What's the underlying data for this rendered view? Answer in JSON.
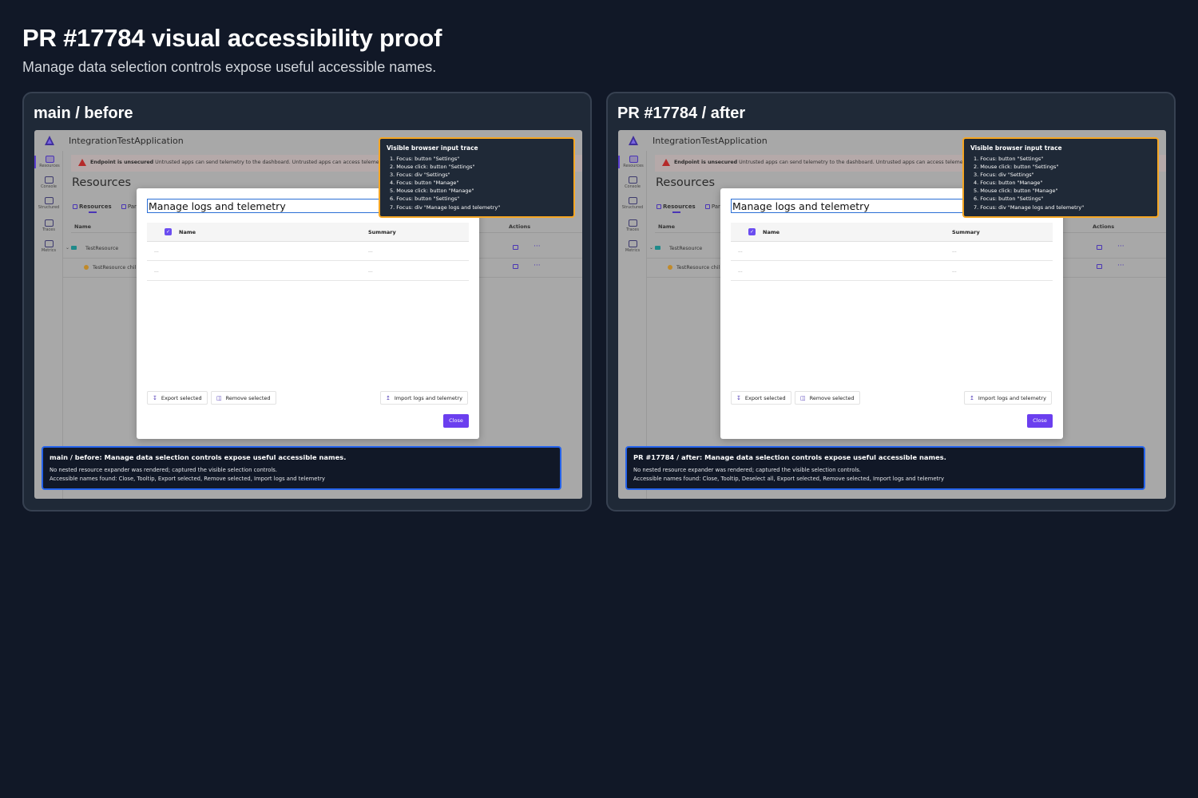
{
  "page": {
    "title": "PR #17784 visual accessibility proof",
    "subtitle": "Manage data selection controls expose useful accessible names."
  },
  "colors": {
    "background": "#111827",
    "panel": "#1f2937",
    "accent": "#6b3fef",
    "trace_border": "#f5a623",
    "summary_border": "#2563eb"
  },
  "panels": [
    {
      "heading": "main / before",
      "app_name": "IntegrationTestApplication",
      "sidebar": [
        "Resources",
        "Console",
        "Structured",
        "Traces",
        "Metrics"
      ],
      "warning": {
        "strong": "Endpoint is unsecured",
        "text": " Untrusted apps can send telemetry to the dashboard. Untrusted apps can access telemetry data via the"
      },
      "resources_title": "Resources",
      "tabs": [
        "Resources",
        "Par"
      ],
      "grid": {
        "col_name": "Name",
        "col_actions": "Actions",
        "rows": [
          "TestResource",
          "TestResource chil"
        ]
      },
      "modal": {
        "title": "Manage logs and telemetry",
        "col_name": "Name",
        "col_summary": "Summary",
        "rows": [
          [
            "...",
            "..."
          ],
          [
            "...",
            "..."
          ]
        ],
        "export_label": "Export selected",
        "remove_label": "Remove selected",
        "import_label": "Import logs and telemetry",
        "close_label": "Close"
      },
      "trace": {
        "title": "Visible browser input trace",
        "items": [
          "1. Focus: button \"Settings\"",
          "2. Mouse click: button \"Settings\"",
          "3. Focus: div \"Settings\"",
          "4. Focus: button \"Manage\"",
          "5. Mouse click: button \"Manage\"",
          "6. Focus: button \"Settings\"",
          "7. Focus: div \"Manage logs and telemetry\""
        ]
      },
      "summary": {
        "title": "main / before: Manage data selection controls expose useful accessible names.",
        "line1": "No nested resource expander was rendered; captured the visible selection controls.",
        "line2": "Accessible names found: Close, Tooltip, Export selected, Remove selected, Import logs and telemetry"
      }
    },
    {
      "heading": "PR #17784 / after",
      "app_name": "IntegrationTestApplication",
      "sidebar": [
        "Resources",
        "Console",
        "Structured",
        "Traces",
        "Metrics"
      ],
      "warning": {
        "strong": "Endpoint is unsecured",
        "text": " Untrusted apps can send telemetry to the dashboard. Untrusted apps can access telemetry data via the"
      },
      "resources_title": "Resources",
      "tabs": [
        "Resources",
        "Par"
      ],
      "grid": {
        "col_name": "Name",
        "col_actions": "Actions",
        "rows": [
          "TestResource",
          "TestResource chil"
        ]
      },
      "modal": {
        "title": "Manage logs and telemetry",
        "col_name": "Name",
        "col_summary": "Summary",
        "rows": [
          [
            "...",
            "..."
          ],
          [
            "...",
            "..."
          ]
        ],
        "export_label": "Export selected",
        "remove_label": "Remove selected",
        "import_label": "Import logs and telemetry",
        "close_label": "Close"
      },
      "trace": {
        "title": "Visible browser input trace",
        "items": [
          "1. Focus: button \"Settings\"",
          "2. Mouse click: button \"Settings\"",
          "3. Focus: div \"Settings\"",
          "4. Focus: button \"Manage\"",
          "5. Mouse click: button \"Manage\"",
          "6. Focus: button \"Settings\"",
          "7. Focus: div \"Manage logs and telemetry\""
        ]
      },
      "summary": {
        "title": "PR #17784 / after: Manage data selection controls expose useful accessible names.",
        "line1": "No nested resource expander was rendered; captured the visible selection controls.",
        "line2": "Accessible names found: Close, Tooltip, Deselect all, Export selected, Remove selected, Import logs and telemetry"
      }
    }
  ]
}
